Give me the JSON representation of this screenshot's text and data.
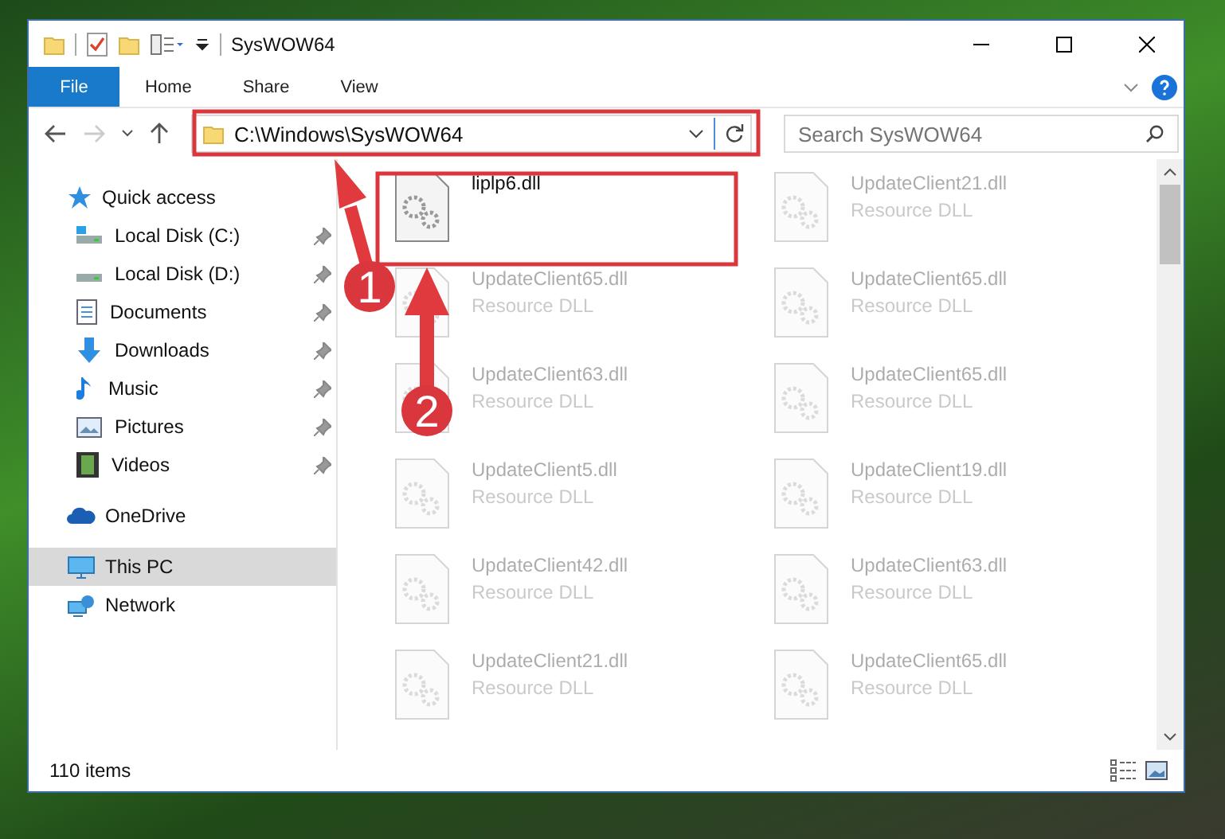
{
  "window": {
    "title": "SysWOW64"
  },
  "ribbon": {
    "tabs": [
      {
        "label": "File",
        "selected": true
      },
      {
        "label": "Home",
        "selected": false
      },
      {
        "label": "Share",
        "selected": false
      },
      {
        "label": "View",
        "selected": false
      }
    ]
  },
  "address_bar": {
    "path": "C:\\Windows\\SysWOW64",
    "forward_disabled": true
  },
  "search": {
    "placeholder": "Search SysWOW64"
  },
  "sidebar": {
    "items": [
      {
        "label": "Quick access",
        "selected": false,
        "children": [
          {
            "label": "Local Disk (C:)",
            "pinned": true
          },
          {
            "label": "Local Disk (D:)",
            "pinned": true
          },
          {
            "label": "Documents",
            "pinned": true
          },
          {
            "label": "Downloads",
            "pinned": true
          },
          {
            "label": "Music",
            "pinned": true
          },
          {
            "label": "Pictures",
            "pinned": true
          },
          {
            "label": "Videos",
            "pinned": true
          }
        ]
      },
      {
        "label": "OneDrive",
        "selected": false
      },
      {
        "label": "This PC",
        "selected": true
      },
      {
        "label": "Network",
        "selected": false
      }
    ]
  },
  "files": [
    {
      "name": "liplp6.dll",
      "blurred": false
    },
    {
      "name": "UpdateClient21.dll",
      "type": "Resource DLL",
      "blurred": true
    },
    {
      "name": "UpdateClient65.dll",
      "type": "Resource DLL",
      "blurred": true
    },
    {
      "name": "UpdateClient65.dll",
      "type": "Resource DLL",
      "blurred": true
    },
    {
      "name": "UpdateClient63.dll",
      "type": "Resource DLL",
      "blurred": true
    },
    {
      "name": "UpdateClient65.dll",
      "type": "Resource DLL",
      "blurred": true
    },
    {
      "name": "UpdateClient5.dll",
      "type": "Resource DLL",
      "blurred": true
    },
    {
      "name": "UpdateClient19.dll",
      "type": "Resource DLL",
      "blurred": true
    },
    {
      "name": "UpdateClient42.dll",
      "type": "Resource DLL",
      "blurred": true
    },
    {
      "name": "UpdateClient63.dll",
      "type": "Resource DLL",
      "blurred": true
    },
    {
      "name": "UpdateClient21.dll",
      "type": "Resource DLL",
      "blurred": true
    },
    {
      "name": "UpdateClient65.dll",
      "type": "Resource DLL",
      "blurred": true
    }
  ],
  "status_bar": {
    "item_count": "110 items"
  },
  "annotations": [
    {
      "label": "1"
    },
    {
      "label": "2"
    }
  ]
}
